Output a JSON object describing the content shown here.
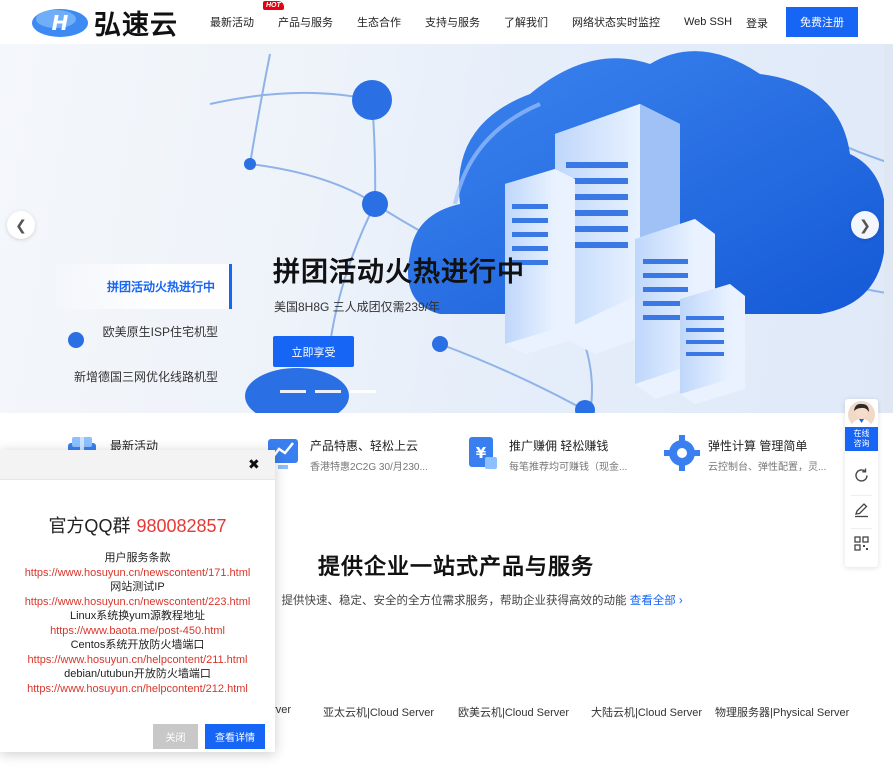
{
  "brand": {
    "name": "弘速云"
  },
  "nav": {
    "items": [
      "最新活动",
      "产品与服务",
      "生态合作",
      "支持与服务",
      "了解我们",
      "网络状态实时监控",
      "Web SSH"
    ],
    "hot_badge": "HOT",
    "login": "登录",
    "register": "免费注册"
  },
  "banner": {
    "tabs": [
      "拼团活动火热进行中",
      "欧美原生ISP住宅机型",
      "新增德国三网优化线路机型"
    ],
    "active_tab": 0,
    "title": "拼团活动火热进行中",
    "subtitle": "美国8H8G 三人成团仅需239/年",
    "button": "立即享受",
    "slide_count": 3,
    "prev_icon": "chevron-left-icon",
    "next_icon": "chevron-right-icon"
  },
  "features": [
    {
      "title": "最新活动",
      "desc": "",
      "icon": "gift-cube-icon"
    },
    {
      "title": "产品特惠、轻松上云",
      "desc": "香港特惠2C2G 30/月230...",
      "icon": "chart-monitor-icon"
    },
    {
      "title": "推广赚佣 轻松赚钱",
      "desc": "每笔推荐均可赚钱（现金...",
      "icon": "yen-document-icon"
    },
    {
      "title": "弹性计算 管理简单",
      "desc": "云控制台、弹性配置，灵...",
      "icon": "gear-cloud-icon"
    }
  ],
  "section": {
    "title": "提供企业一站式产品与服务",
    "desc": "，提供快速、稳定、安全的全方位需求服务，帮助企业获得高效的动能",
    "link": "查看全部",
    "categories": [
      "erver",
      "亚太云机|Cloud Server",
      "欧美云机|Cloud Server",
      "大陆云机|Cloud Server",
      "物理服务器|Physical Server"
    ]
  },
  "float_bar": {
    "online": [
      "在线",
      "咨询"
    ],
    "icons": [
      "refresh-icon",
      "edit-icon",
      "qrcode-icon"
    ]
  },
  "popup": {
    "close_icon": "close-icon",
    "qq_label": "官方QQ群",
    "qq_number": "980082857",
    "links": [
      {
        "label": "用户服务条款",
        "url": "https://www.hosuyun.cn/newscontent/171.html"
      },
      {
        "label": "网站测试IP",
        "url": "https://www.hosuyun.cn/newscontent/223.html"
      },
      {
        "label": "Linux系统换yum源教程地址",
        "url": "https://www.baota.me/post-450.html"
      },
      {
        "label": "Centos系统开放防火墙端口",
        "url": "https://www.hosuyun.cn/helpcontent/211.html"
      },
      {
        "label": "debian/utubun开放防火墙端口",
        "url": "https://www.hosuyun.cn/helpcontent/212.html"
      }
    ],
    "btn_close": "关闭",
    "btn_detail": "查看详情"
  },
  "colors": {
    "primary": "#1765f5",
    "accent_red": "#d9362b",
    "hot": "#e60012"
  }
}
